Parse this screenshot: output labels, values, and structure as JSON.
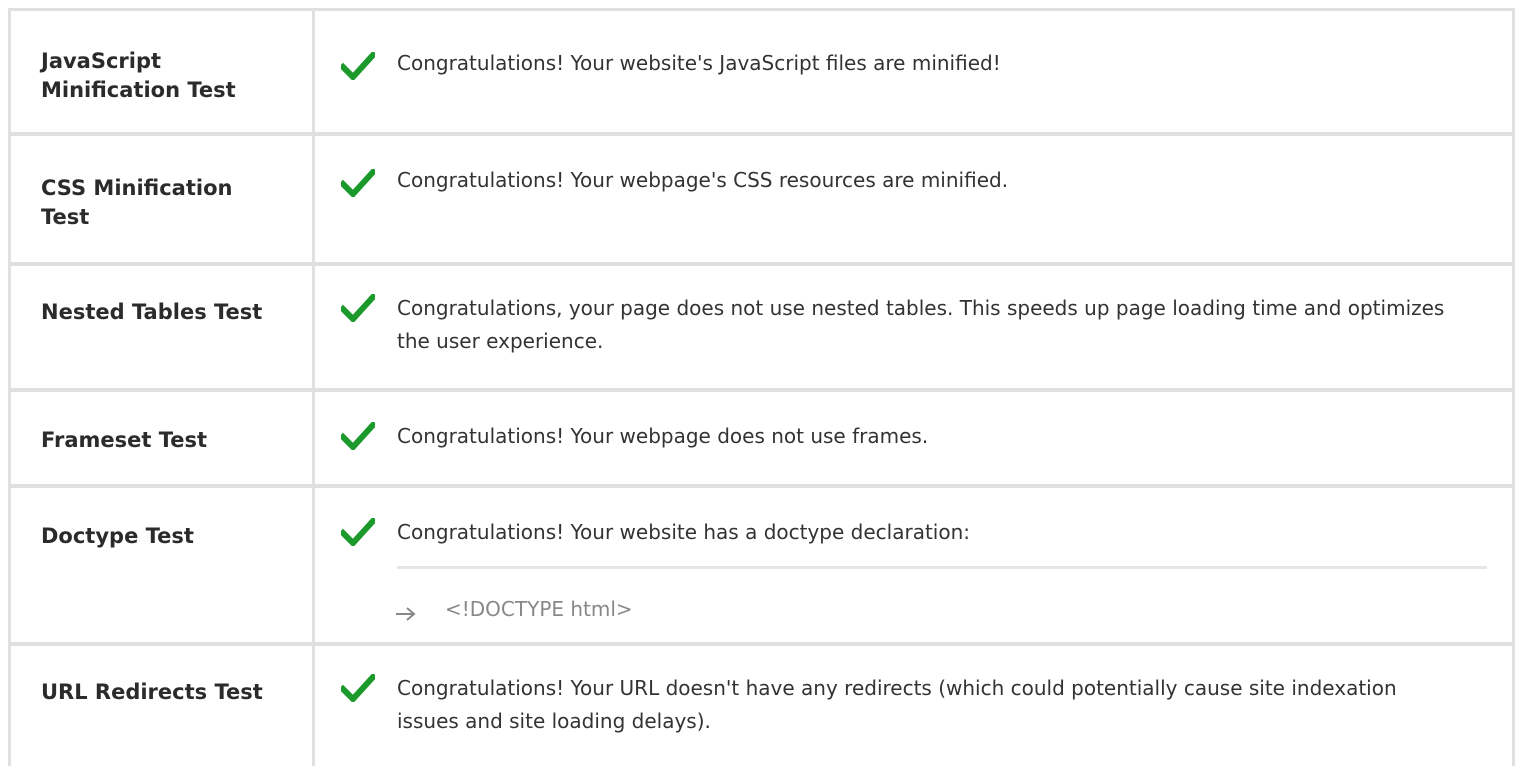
{
  "colors": {
    "check": "#1b9a2b",
    "border": "#e0e0e0",
    "label": "#2b2b2b",
    "text": "#333333",
    "muted": "#888888"
  },
  "rows": [
    {
      "label": "JavaScript Minification Test",
      "icon": "check-icon",
      "message": "Congratulations! Your website's JavaScript files are minified!"
    },
    {
      "label": "CSS Minification Test",
      "icon": "check-icon",
      "message": "Congratulations! Your webpage's CSS resources are minified."
    },
    {
      "label": "Nested Tables Test",
      "icon": "check-icon",
      "message": "Congratulations, your page does not use nested tables. This speeds up page loading time and optimizes the user experience."
    },
    {
      "label": "Frameset Test",
      "icon": "check-icon",
      "message": "Congratulations! Your webpage does not use frames."
    },
    {
      "label": "Doctype Test",
      "icon": "check-icon",
      "message": "Congratulations! Your website has a doctype declaration:",
      "detail_icon": "arrow-right-icon",
      "detail": "<!DOCTYPE html>"
    },
    {
      "label": "URL Redirects Test",
      "icon": "check-icon",
      "message": "Congratulations! Your URL doesn't have any redirects (which could potentially cause site indexation issues and site loading delays)."
    }
  ]
}
